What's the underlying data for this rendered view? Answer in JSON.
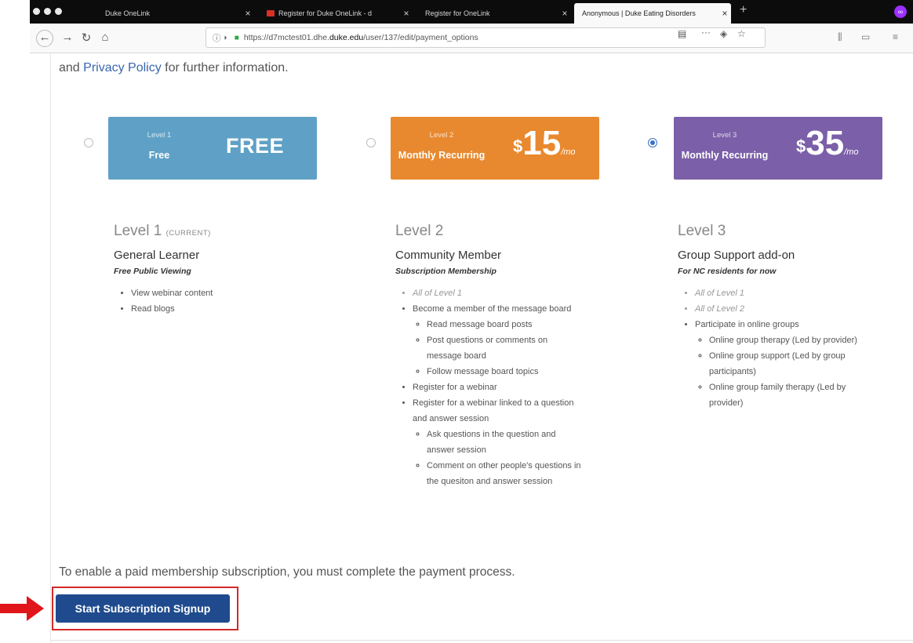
{
  "browser": {
    "tabs": [
      {
        "label": "Duke OneLink",
        "active": false
      },
      {
        "label": "Register for Duke OneLink - d",
        "active": false
      },
      {
        "label": "Register for OneLink",
        "active": false
      },
      {
        "label": "Anonymous | Duke Eating Disorders",
        "active": true
      }
    ],
    "tab_close": "×",
    "new_tab": "+",
    "url_prefix": "https://d7mctest01.dhe.",
    "url_host": "duke.edu",
    "url_path": "/user/137/edit/payment_options",
    "overflow_menu": "···"
  },
  "page": {
    "intro_link": "Privacy Policy",
    "intro_before": "and ",
    "intro_after": " for further information.",
    "tiers": [
      {
        "card_level": "Level 1",
        "card_sub": "Free",
        "card_price": "FREE",
        "color": "#5fa1c6",
        "selected": false
      },
      {
        "card_level": "Level 2",
        "card_sub": "Monthly Recurring",
        "currency": "$",
        "amount": "15",
        "per": "/mo",
        "color": "#e8892f",
        "selected": false
      },
      {
        "card_level": "Level 3",
        "card_sub": "Monthly Recurring",
        "currency": "$",
        "amount": "35",
        "per": "/mo",
        "color": "#7b5fa8",
        "selected": true
      }
    ],
    "columns": [
      {
        "title": "Level 1",
        "title_suffix": "(CURRENT)",
        "name": "General Learner",
        "tag": "Free Public Viewing",
        "items": [
          "View webinar content",
          "Read blogs"
        ]
      },
      {
        "title": "Level 2",
        "name": "Community Member",
        "tag": "Subscription Membership",
        "items": [
          "All of Level 1",
          "Become a member of the message board",
          "Read message board posts",
          "Post questions or comments on message board",
          "Follow message board topics",
          "Register for a webinar",
          "Register for a webinar linked to a question and answer session",
          "Ask questions in the question and answer session",
          "Comment on other people's questions in the quesiton and answer session"
        ]
      },
      {
        "title": "Level 3",
        "name": "Group Support add-on",
        "tag": "For NC residents for now",
        "items": [
          "All of Level 1",
          "All of Level 2",
          "Participate in online groups",
          "Online group therapy (Led by provider)",
          "Online group support (Led by group participants)",
          "Online group family therapy (Led by provider)"
        ]
      }
    ],
    "notice": "To enable a paid membership subscription, you must complete the payment process.",
    "signup_button": "Start Subscription Signup"
  },
  "colors": {
    "highlight": "#d42a2a",
    "button": "#1f4b8e",
    "link": "#3a66b0"
  }
}
